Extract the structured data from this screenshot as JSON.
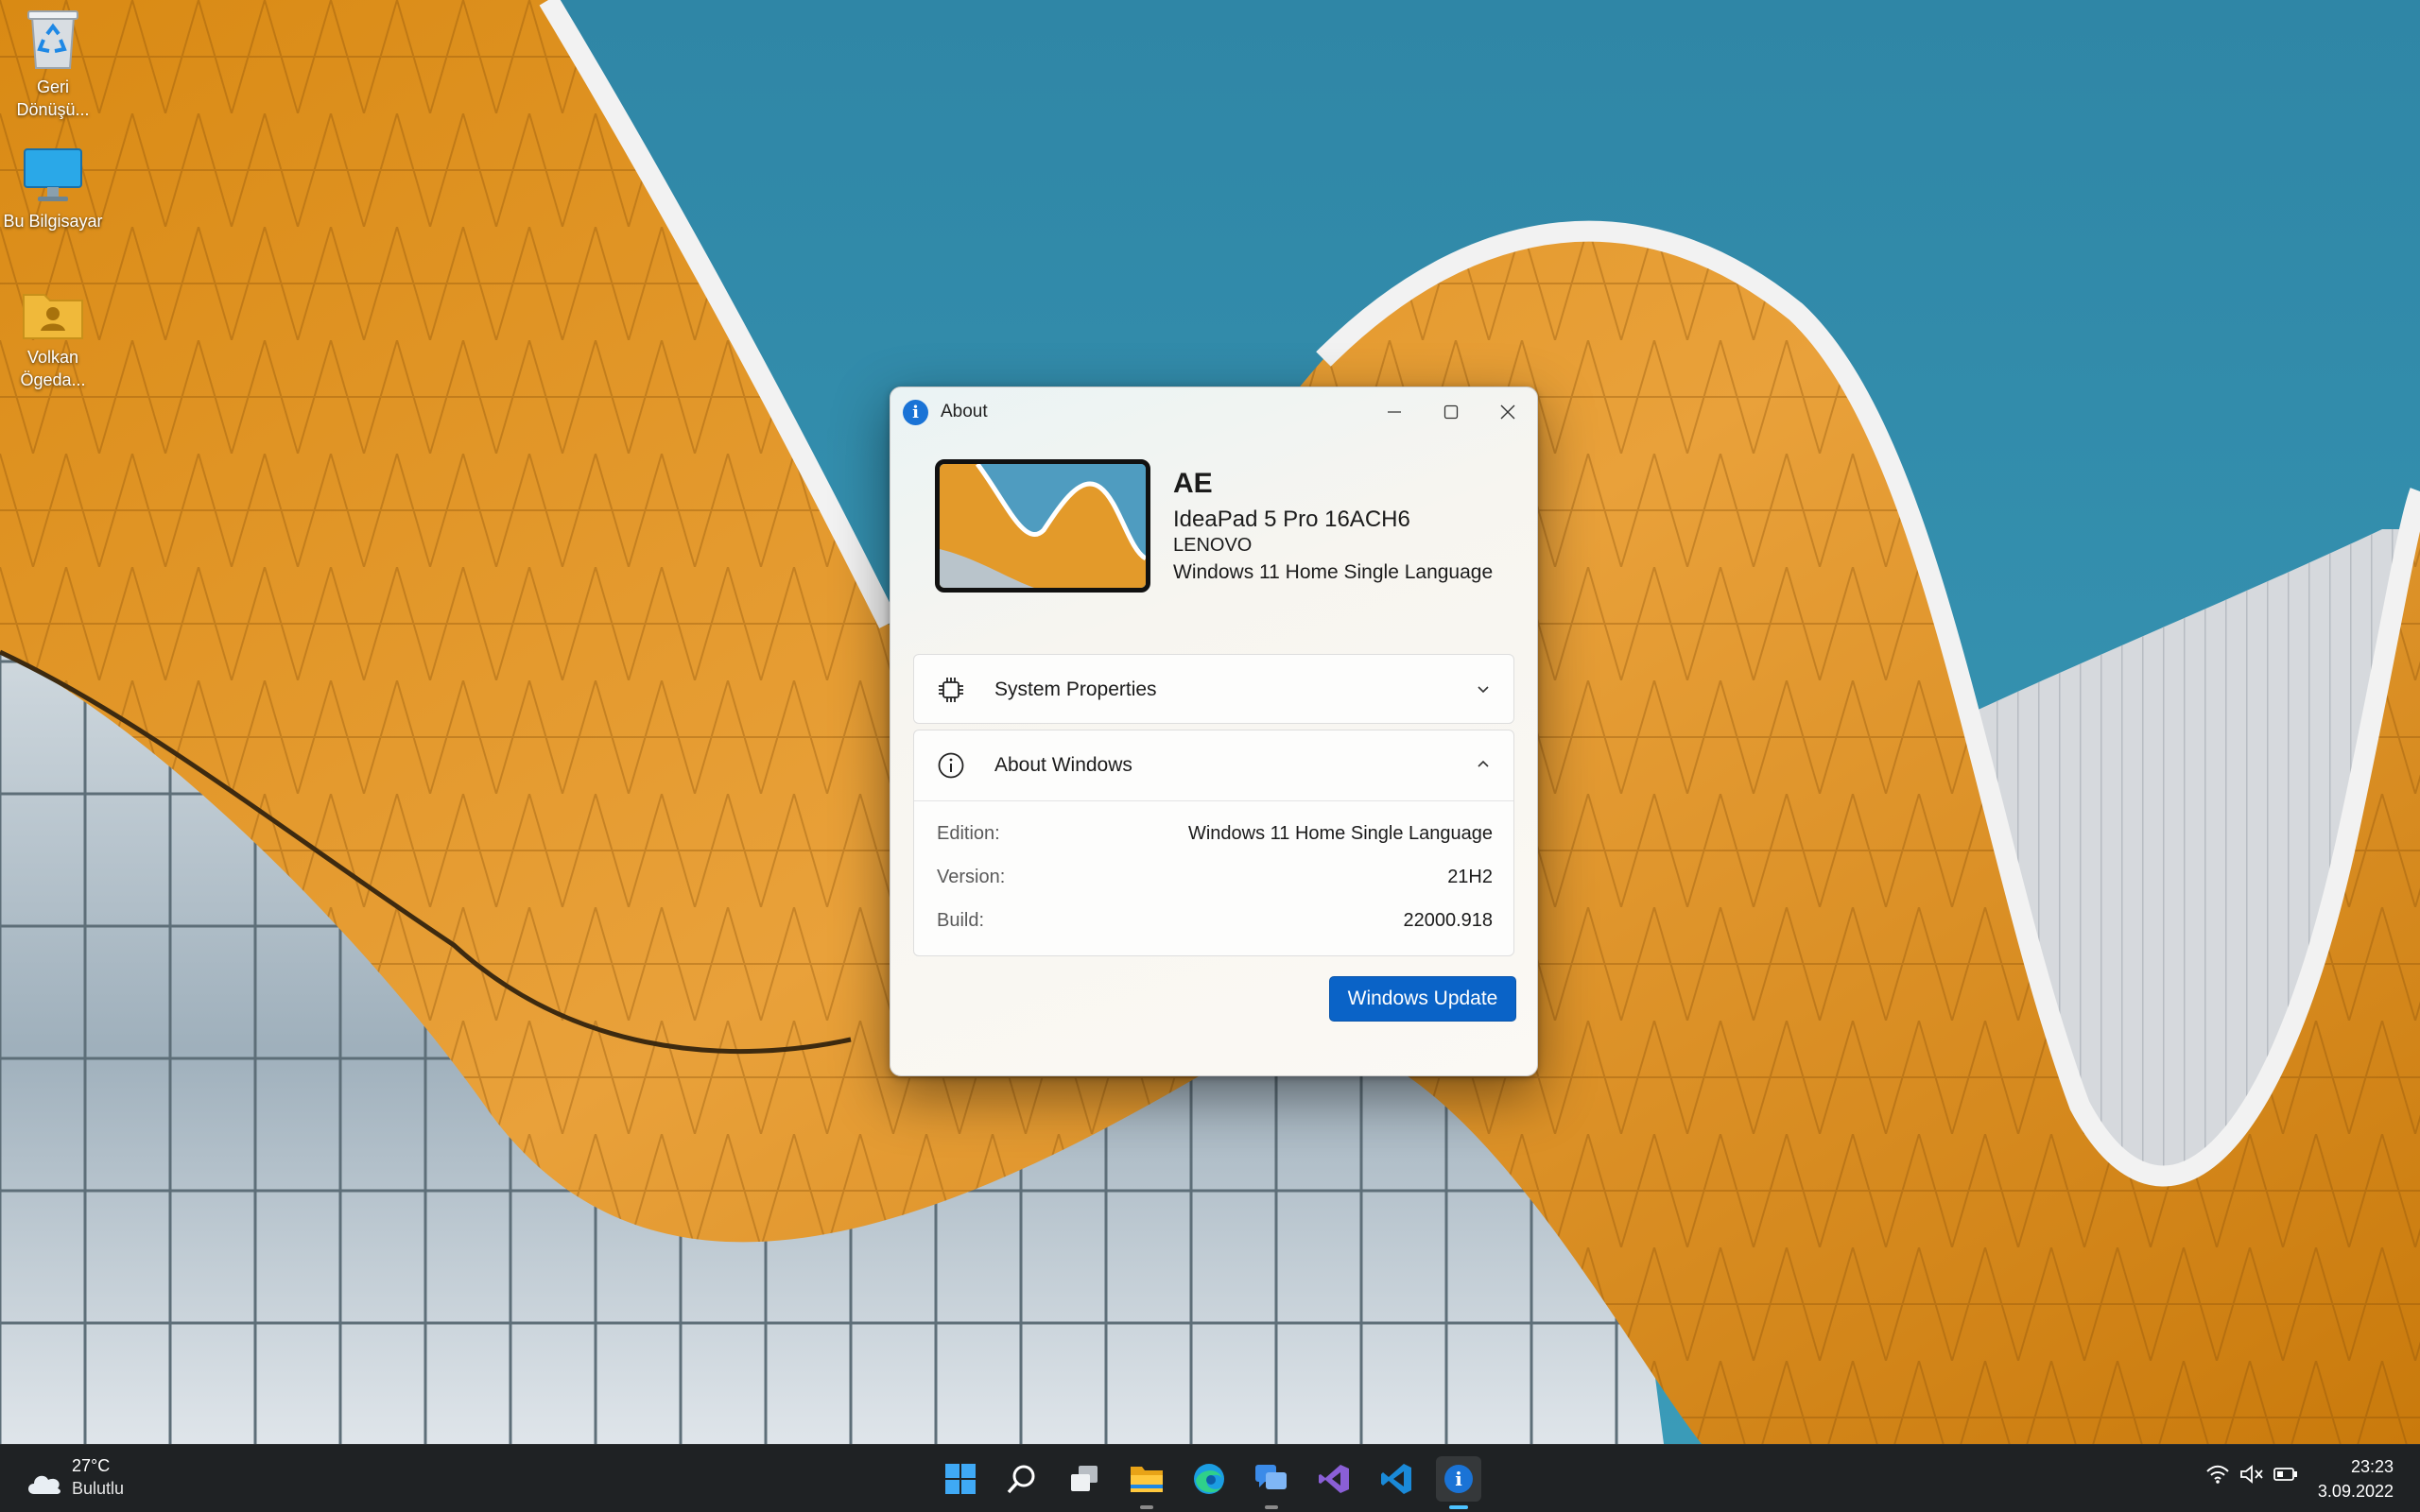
{
  "desktop": {
    "icons": [
      {
        "label": "Geri Dönüşü...",
        "icon": "recycle-bin-icon"
      },
      {
        "label": "Bu Bilgisayar",
        "icon": "this-pc-icon"
      },
      {
        "label": "Volkan Ögeda...",
        "icon": "user-folder-icon"
      }
    ]
  },
  "dialog": {
    "title": "About",
    "device": {
      "name": "AE",
      "model": "IdeaPad 5 Pro 16ACH6",
      "manufacturer": "LENOVO",
      "os": "Windows 11 Home Single Language"
    },
    "system_properties": {
      "label": "System Properties",
      "expanded": false
    },
    "about_windows": {
      "label": "About Windows",
      "expanded": true,
      "rows": [
        {
          "key": "Edition:",
          "value": "Windows 11 Home Single Language"
        },
        {
          "key": "Version:",
          "value": "21H2"
        },
        {
          "key": "Build:",
          "value": "22000.918"
        }
      ]
    },
    "update_button": "Windows Update"
  },
  "taskbar": {
    "weather": {
      "temp": "27°C",
      "condition": "Bulutlu"
    },
    "apps": [
      "start-icon",
      "search-icon",
      "task-view-icon",
      "file-explorer-icon",
      "edge-icon",
      "chat-icon",
      "visual-studio-icon",
      "vscode-icon",
      "about-app-icon"
    ],
    "clock": {
      "time": "23:23",
      "date": "3.09.2022"
    }
  },
  "colors": {
    "accent": "#0a63c7",
    "active_indicator": "#4cc2ff"
  }
}
